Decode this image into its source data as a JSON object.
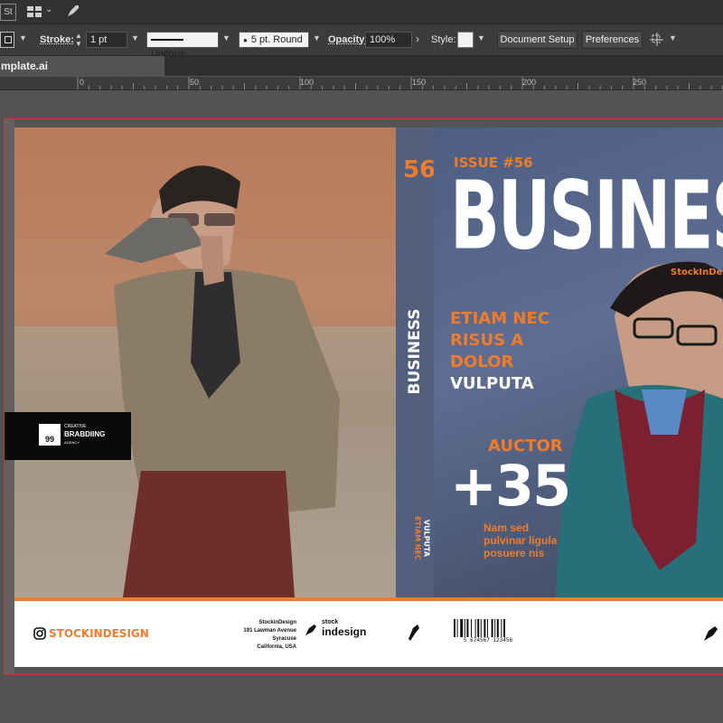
{
  "app": {
    "doc_tab": "mplate.ai",
    "st_label": "St"
  },
  "control_bar": {
    "stroke_label": "Stroke:",
    "stroke_value": "1 pt",
    "profile_value": "Uniform",
    "brush_value": "5 pt. Round",
    "opacity_label": "Opacity:",
    "opacity_value": "100%",
    "style_label": "Style:",
    "document_setup": "Document Setup",
    "preferences": "Preferences"
  },
  "ruler": [
    "0",
    "50",
    "100",
    "150",
    "200",
    "250"
  ],
  "spine": {
    "issue_number": "56",
    "title": "BUSINESS",
    "line1": "ETIAM NEC",
    "line2": "VULPUTA"
  },
  "front_cover": {
    "issue": "ISSUE #56",
    "masthead": "BUSINES",
    "brand": "StockInDesign",
    "headline1": "ETIAM NEC",
    "headline2": "RISUS A",
    "headline3": "DOLOR",
    "headline4": "VULPUTA",
    "auctor": "AUCTOR",
    "big_number": "+35",
    "sub1": "Nam sed",
    "sub2": "pulvinar ligula",
    "sub3": "posuere nis"
  },
  "back_cover": {
    "logo_number": "99",
    "logo_line1": "CREATIVE",
    "logo_line2": "BRABDIING",
    "logo_line3": "AGENCY"
  },
  "footer": {
    "instagram": "STOCKINDESIGN",
    "address1": "StockinDesign",
    "address2": "191 Lawman Avenue",
    "address3": "Syracuse",
    "address4": "California, USA",
    "logo_small": "stock",
    "logo_big": "indesign",
    "barcode_digits": "5 674567 123456"
  },
  "colors": {
    "accent": "#f07c2b",
    "spine": "#52607e",
    "toolbar": "#3c3c3c"
  }
}
